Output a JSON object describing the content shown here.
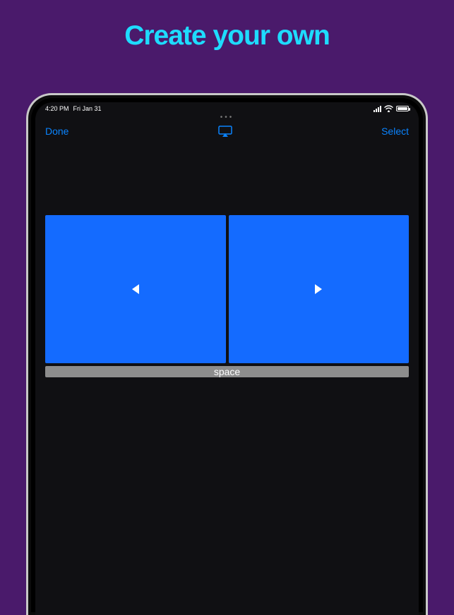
{
  "hero": {
    "title": "Create your own"
  },
  "status": {
    "time": "4:20 PM",
    "date": "Fri Jan 31"
  },
  "nav": {
    "done": "Done",
    "select": "Select"
  },
  "buttons": {
    "prev": {
      "icon": "triangle-left-icon"
    },
    "next": {
      "icon": "triangle-right-icon"
    },
    "space": {
      "label": "space"
    }
  }
}
